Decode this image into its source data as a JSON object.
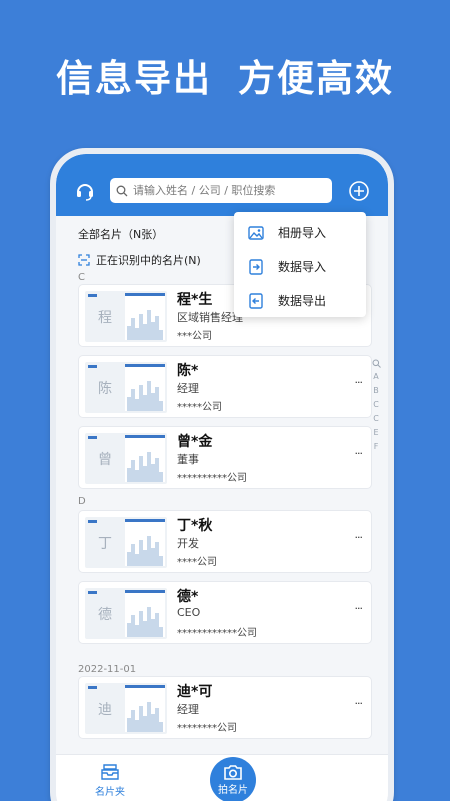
{
  "promo": {
    "headline_left": "信息导出",
    "headline_right": "方便高效"
  },
  "search": {
    "placeholder": "请输入姓名 / 公司 / 职位搜索"
  },
  "list": {
    "all_cards_label": "全部名片（N张）",
    "recognizing_label": "正在识别中的名片(N)"
  },
  "menu": {
    "items": [
      {
        "label": "相册导入",
        "icon": "photo-album-icon"
      },
      {
        "label": "数据导入",
        "icon": "data-import-icon"
      },
      {
        "label": "数据导出",
        "icon": "data-export-icon"
      }
    ]
  },
  "sections": [
    {
      "label": "C"
    },
    {
      "label": "D"
    },
    {
      "label": "2022-11-01"
    }
  ],
  "cards": [
    {
      "thumb_char": "程",
      "name": "程*生",
      "title": "区域销售经理",
      "company": "***公司"
    },
    {
      "thumb_char": "陈",
      "name": "陈*",
      "title": "经理",
      "company": "*****公司"
    },
    {
      "thumb_char": "曾",
      "name": "曾*金",
      "title": "董事",
      "company": "**********公司"
    },
    {
      "thumb_char": "丁",
      "name": "丁*秋",
      "title": "开发",
      "company": "****公司"
    },
    {
      "thumb_char": "德",
      "name": "德*",
      "title": "CEO",
      "company": "************公司"
    },
    {
      "thumb_char": "迪",
      "name": "迪*可",
      "title": "经理",
      "company": "********公司"
    }
  ],
  "alpha_index": [
    "A",
    "B",
    "C",
    "C",
    "E",
    "F"
  ],
  "tabs": {
    "cards_label": "名片夹",
    "photo_label": "拍名片"
  },
  "more_glyph": "···",
  "colors": {
    "background": "#3d7fd8",
    "accent": "#2f80dc"
  }
}
